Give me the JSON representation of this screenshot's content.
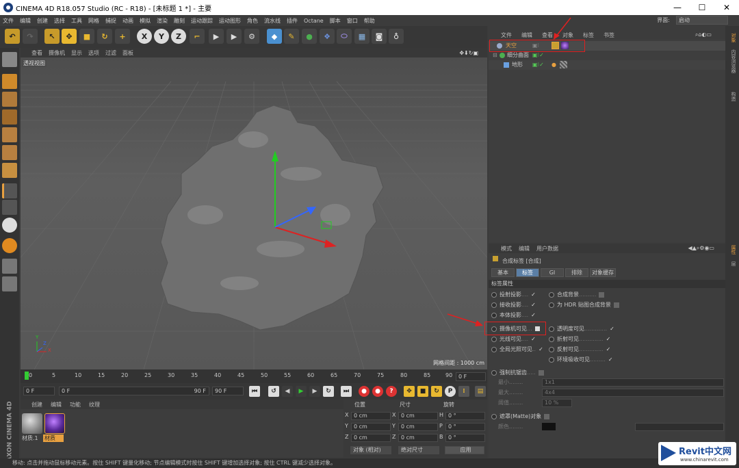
{
  "window": {
    "title": "CINEMA 4D R18.057 Studio (RC - R18) - [未标题 1 *] - 主要",
    "minimize": "—",
    "maximize": "☐",
    "close": "✕"
  },
  "menubar": {
    "items": [
      "文件",
      "编辑",
      "创建",
      "选择",
      "工具",
      "网格",
      "捕捉",
      "动画",
      "模拟",
      "渲染",
      "雕刻",
      "运动跟踪",
      "运动图形",
      "角色",
      "流水线",
      "插件",
      "Octane",
      "脚本",
      "窗口",
      "帮助"
    ],
    "layout_label": "界面:",
    "layout_value": "启动"
  },
  "toolbar": {
    "x_label": "X",
    "y_label": "Y",
    "z_label": "Z"
  },
  "viewport": {
    "menu": [
      "查看",
      "摄像机",
      "显示",
      "选项",
      "过滤",
      "面板"
    ],
    "title": "透视视图",
    "grid_spacing": "网格间距 : 1000 cm",
    "axis_y": "Y",
    "axis_x": "X",
    "axis_z": "Z"
  },
  "timeline": {
    "ticks": [
      "0",
      "5",
      "10",
      "15",
      "20",
      "25",
      "30",
      "35",
      "40",
      "45",
      "50",
      "55",
      "60",
      "65",
      "70",
      "75",
      "80",
      "85",
      "90"
    ],
    "end_field": "0 F"
  },
  "playback": {
    "start": "0 F",
    "current": "0 F",
    "end_marker": "90 F",
    "end": "90 F"
  },
  "materials": {
    "menu": [
      "创建",
      "编辑",
      "功能",
      "纹理"
    ],
    "items": [
      {
        "name": "材质.1"
      },
      {
        "name": "材质"
      }
    ]
  },
  "coordinates": {
    "headers": [
      "位置",
      "尺寸",
      "旋转"
    ],
    "rows": [
      {
        "a": "X",
        "av": "0 cm",
        "b": "X",
        "bv": "0 cm",
        "c": "H",
        "cv": "0 °"
      },
      {
        "a": "Y",
        "av": "0 cm",
        "b": "Y",
        "bv": "0 cm",
        "c": "P",
        "cv": "0 °"
      },
      {
        "a": "Z",
        "av": "0 cm",
        "b": "Z",
        "bv": "0 cm",
        "c": "B",
        "cv": "0 °"
      }
    ],
    "mode": "对象 (相对)",
    "size_mode": "绝对尺寸",
    "apply": "应用"
  },
  "status": "移动: 点击并拖动鼠标移动元素。按住 SHIFT 键量化移动; 节点编辑模式时按住 SHIFT 键增加选择对象; 按住 CTRL 键减少选择对象。",
  "maxon": "MAXON CINEMA 4D",
  "objects": {
    "menu": [
      "文件",
      "编辑",
      "查看",
      "对象",
      "标签",
      "书签"
    ],
    "rows": [
      {
        "name": "天空",
        "color": "#e8a040"
      },
      {
        "name": "细分曲面",
        "color": "#cfcfcf"
      },
      {
        "name": "地形",
        "color": "#cfcfcf"
      }
    ]
  },
  "attributes": {
    "menu": [
      "模式",
      "编辑",
      "用户数据"
    ],
    "title": "合成标签 [合成]",
    "tabs": [
      "基本",
      "标签",
      "GI",
      "排除",
      "对象缓存"
    ],
    "section": "标签属性",
    "left_props": [
      {
        "label": "投射投影",
        "check": "✓"
      },
      {
        "label": "接收投影",
        "check": "✓"
      },
      {
        "label": "本体投影",
        "check": "✓"
      },
      {
        "label": "摄像机可见",
        "check": ""
      },
      {
        "label": "光线可见",
        "check": "✓"
      },
      {
        "label": "全局光照可见",
        "check": "✓"
      }
    ],
    "right_props": [
      {
        "label": "合成背景",
        "check": ""
      },
      {
        "label": "为 HDR 贴图合成背景",
        "check": ""
      },
      {
        "label": "透明度可见",
        "check": "✓"
      },
      {
        "label": "折射可见",
        "check": "✓"
      },
      {
        "label": "反射可见",
        "check": "✓"
      },
      {
        "label": "环境吸收可见",
        "check": "✓"
      }
    ],
    "aa": {
      "label": "强制抗锯齿",
      "min_label": "最小",
      "min": "1x1",
      "max_label": "最大",
      "max": "4x4",
      "threshold_label": "阈值",
      "threshold": "10 %"
    },
    "matte": {
      "label": "遮罩(Matte)对象",
      "color_label": "颜色"
    }
  },
  "right_tabs": [
    "对象",
    "内容浏览器",
    "构造",
    "属性",
    "层"
  ],
  "watermark": {
    "brand": "Revit中文网",
    "url": "www.chinarevit.com"
  },
  "colors": {
    "accent": "#e02020",
    "select_blue": "#5b7fa6",
    "grid_orange": "#e8a040"
  }
}
